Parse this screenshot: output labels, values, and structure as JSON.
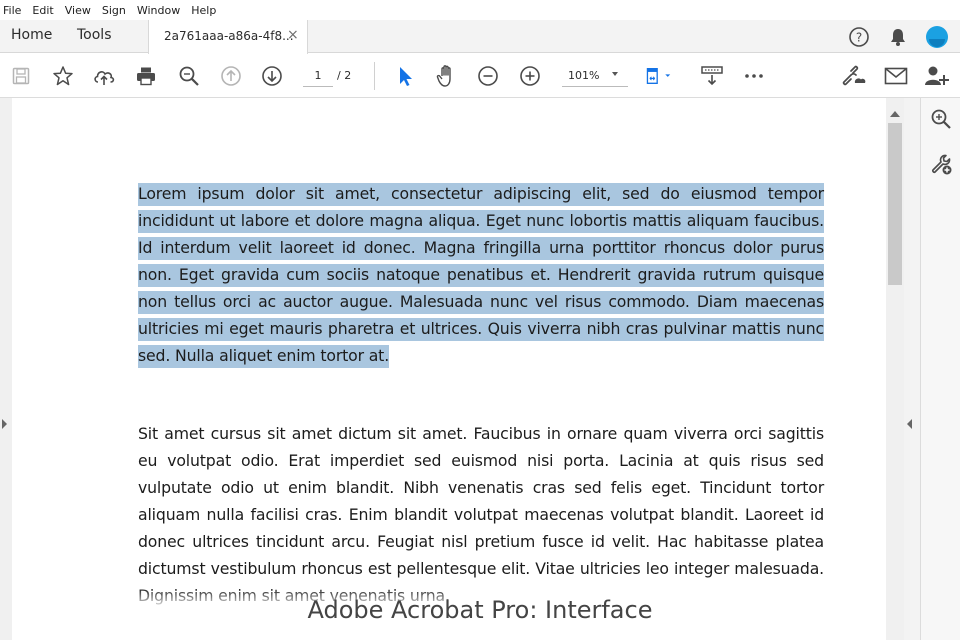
{
  "menu": [
    "File",
    "Edit",
    "View",
    "Sign",
    "Window",
    "Help"
  ],
  "tabs": {
    "home": "Home",
    "tools": "Tools",
    "document_title": "2a761aaa-a86a-4f8...",
    "close": "×"
  },
  "header_icons": [
    "help-icon",
    "notifications-bell-icon",
    "account-avatar-icon"
  ],
  "toolbar": {
    "page_current": "1",
    "page_total": "/ 2",
    "zoom": "101%",
    "icons": [
      "save-icon",
      "bookmark-star-icon",
      "upload-cloud-icon",
      "print-icon",
      "zoom-search-icon",
      "previous-page-icon",
      "next-page-icon",
      "select-pointer-icon",
      "hand-pan-icon",
      "zoom-out-icon",
      "zoom-in-icon",
      "page-fit-icon",
      "scroll-mode-icon",
      "more-options-icon",
      "share-link-icon",
      "email-icon",
      "add-user-icon"
    ]
  },
  "right_panel": [
    "zoom-panel-icon",
    "tools-wrench-icon"
  ],
  "document": {
    "paragraph_1": "Lorem ipsum dolor sit amet, consectetur adipiscing elit, sed do eiusmod tempor incididunt ut labore et dolore magna aliqua. Eget nunc lobortis mattis aliquam faucibus. Id interdum velit laoreet id donec. Magna fringilla urna porttitor rhoncus dolor purus non. Eget gravida cum sociis natoque penatibus et. Hendrerit gravida rutrum quisque non tellus orci ac auctor augue. Malesuada nunc vel risus commodo. Diam maecenas ultricies mi eget mauris pharetra et ultrices. Quis viverra nibh cras pulvinar mattis nunc sed. Nulla aliquet enim tortor at.",
    "paragraph_2": "Sit amet cursus sit amet dictum sit amet. Faucibus in ornare quam viverra orci sagittis eu volutpat odio. Erat imperdiet sed euismod nisi porta. Lacinia at quis risus sed vulputate odio ut enim blandit. Nibh venenatis cras sed felis eget. Tincidunt tortor aliquam nulla facilisi cras. Enim blandit volutpat maecenas volutpat blandit. Laoreet id donec ultrices tincidunt arcu. Feugiat nisl pretium fusce id velit. Hac habitasse platea dictumst vestibulum rhoncus est pellentesque elit. Vitae ultricies leo integer malesuada. Dignissim enim sit amet venenatis urna."
  },
  "caption": "Adobe Acrobat Pro: Interface",
  "colors": {
    "selection_highlight": "#a9c6df",
    "accent_blue": "#1473e6",
    "avatar": "#1ba1e2"
  }
}
